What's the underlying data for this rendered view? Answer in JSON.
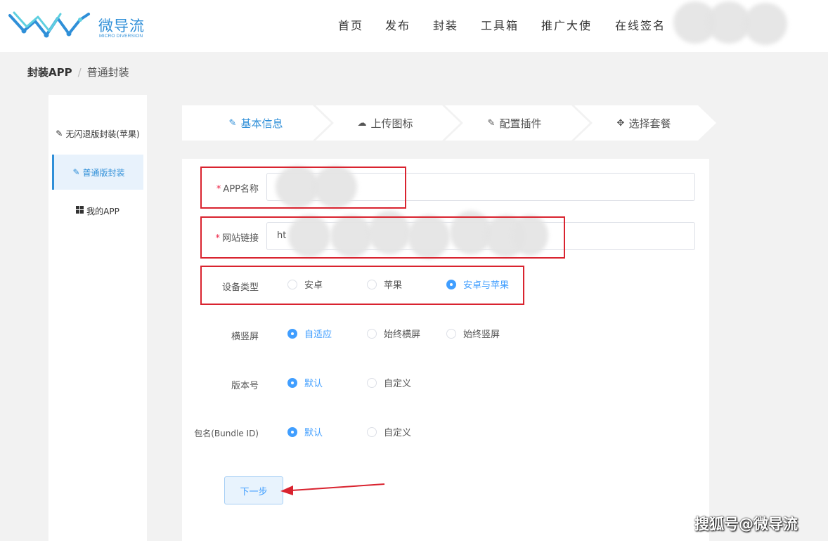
{
  "logo": {
    "cn": "微导流",
    "en": "MICRO DIVERSION",
    "mark_icon": "zigzag-circuit-logo",
    "brand_color": "#2f8fd8"
  },
  "nav": {
    "items": [
      "首页",
      "发布",
      "封装",
      "工具箱",
      "推广大使",
      "在线签名"
    ]
  },
  "breadcrumb": {
    "current": "封装APP",
    "separator": "/",
    "link": "普通封装"
  },
  "sidebar": {
    "items": [
      {
        "icon": "pencil-icon",
        "label": "无闪退版封装(苹果)"
      },
      {
        "icon": "edit-icon",
        "label": "普通版封装"
      },
      {
        "icon": "grid-icon",
        "label": "我的APP"
      }
    ]
  },
  "steps": [
    {
      "icon": "pencil-icon",
      "label": "基本信息"
    },
    {
      "icon": "cloud-upload-icon",
      "label": "上传图标"
    },
    {
      "icon": "edit-icon",
      "label": "配置插件"
    },
    {
      "icon": "move-icon",
      "label": "选择套餐"
    }
  ],
  "form": {
    "app_name": {
      "label": "APP名称",
      "required_mark": "*",
      "value": ""
    },
    "website": {
      "label": "网站链接",
      "required_mark": "*",
      "value": "ht"
    },
    "device": {
      "label": "设备类型",
      "options": [
        "安卓",
        "苹果",
        "安卓与苹果"
      ],
      "selected": "安卓与苹果"
    },
    "orientation": {
      "label": "横竖屏",
      "options": [
        "自适应",
        "始终横屏",
        "始终竖屏"
      ],
      "selected": "自适应"
    },
    "version": {
      "label": "版本号",
      "options": [
        "默认",
        "自定义"
      ],
      "selected": "默认"
    },
    "bundle": {
      "label": "包名(Bundle ID)",
      "options": [
        "默认",
        "自定义"
      ],
      "selected": "默认"
    },
    "next_button": "下一步"
  },
  "colors": {
    "accent": "#409eff",
    "annotation_red": "#d9232f"
  },
  "watermark": "搜狐号@微导流"
}
